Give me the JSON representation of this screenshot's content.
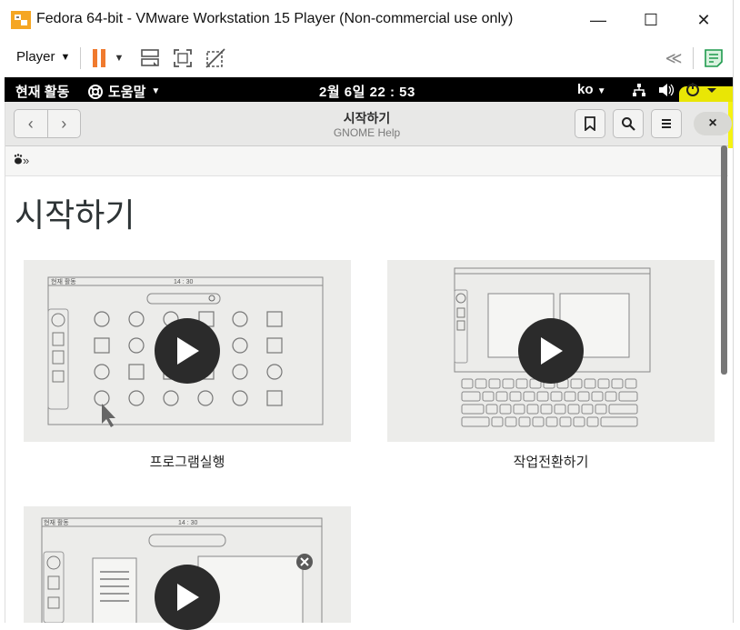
{
  "window": {
    "title": "Fedora 64-bit - VMware Workstation 15 Player (Non-commercial use only)",
    "minimize": "—",
    "maximize": "☐",
    "close": "✕"
  },
  "toolbar": {
    "player_label": "Player",
    "player_arrow": "▼",
    "pause_arrow": "▼",
    "back_glyph": "≪"
  },
  "gnome_bar": {
    "activities": "현재 활동",
    "help_menu": "도움말",
    "help_arrow": "▼",
    "clock": "2월 6일  22 : 53",
    "lang": "ko",
    "lang_arrow": "▼"
  },
  "help_header": {
    "title": "시작하기",
    "subtitle": "GNOME Help",
    "back": "‹",
    "forward": "›",
    "close": "×"
  },
  "breadcrumb": {
    "home": "»"
  },
  "page": {
    "title": "시작하기",
    "cards": [
      {
        "label": "프로그램실행",
        "screen_time": "14 : 30",
        "screen_act": "현재 활동"
      },
      {
        "label": "작업전환하기"
      },
      {
        "label": "",
        "screen_time": "14 : 30",
        "screen_act": "현재 활동"
      }
    ]
  },
  "colors": {
    "highlight": "#f6f205",
    "pause": "#f07a2e",
    "gnome_bar": "#000000",
    "header_bar": "#e8e8e7"
  }
}
